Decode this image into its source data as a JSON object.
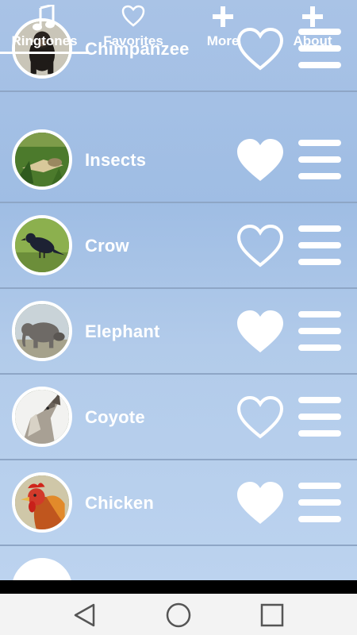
{
  "tabs": [
    {
      "label": "Ringtones",
      "icon": "music-note-icon",
      "active": true
    },
    {
      "label": "Favorites",
      "icon": "heart-outline-icon",
      "active": false
    },
    {
      "label": "More",
      "icon": "plus-icon",
      "active": false
    },
    {
      "label": "About",
      "icon": "plus-icon",
      "active": false
    }
  ],
  "ringtones": [
    {
      "name": "Chimpanzee",
      "favorite": false
    },
    {
      "name": "Insects",
      "favorite": true
    },
    {
      "name": "Crow",
      "favorite": false
    },
    {
      "name": "Elephant",
      "favorite": true
    },
    {
      "name": "Coyote",
      "favorite": false
    },
    {
      "name": "Chicken",
      "favorite": true
    }
  ],
  "navbar": {
    "back": "back-triangle-icon",
    "home": "home-circle-icon",
    "recents": "recents-square-icon"
  },
  "colors": {
    "accent": "#ffffff",
    "background_top": "#a9c3e6",
    "background_bottom": "#bcd3ef",
    "divider": "#8ea6c6",
    "navbar": "#f3f3f3"
  }
}
